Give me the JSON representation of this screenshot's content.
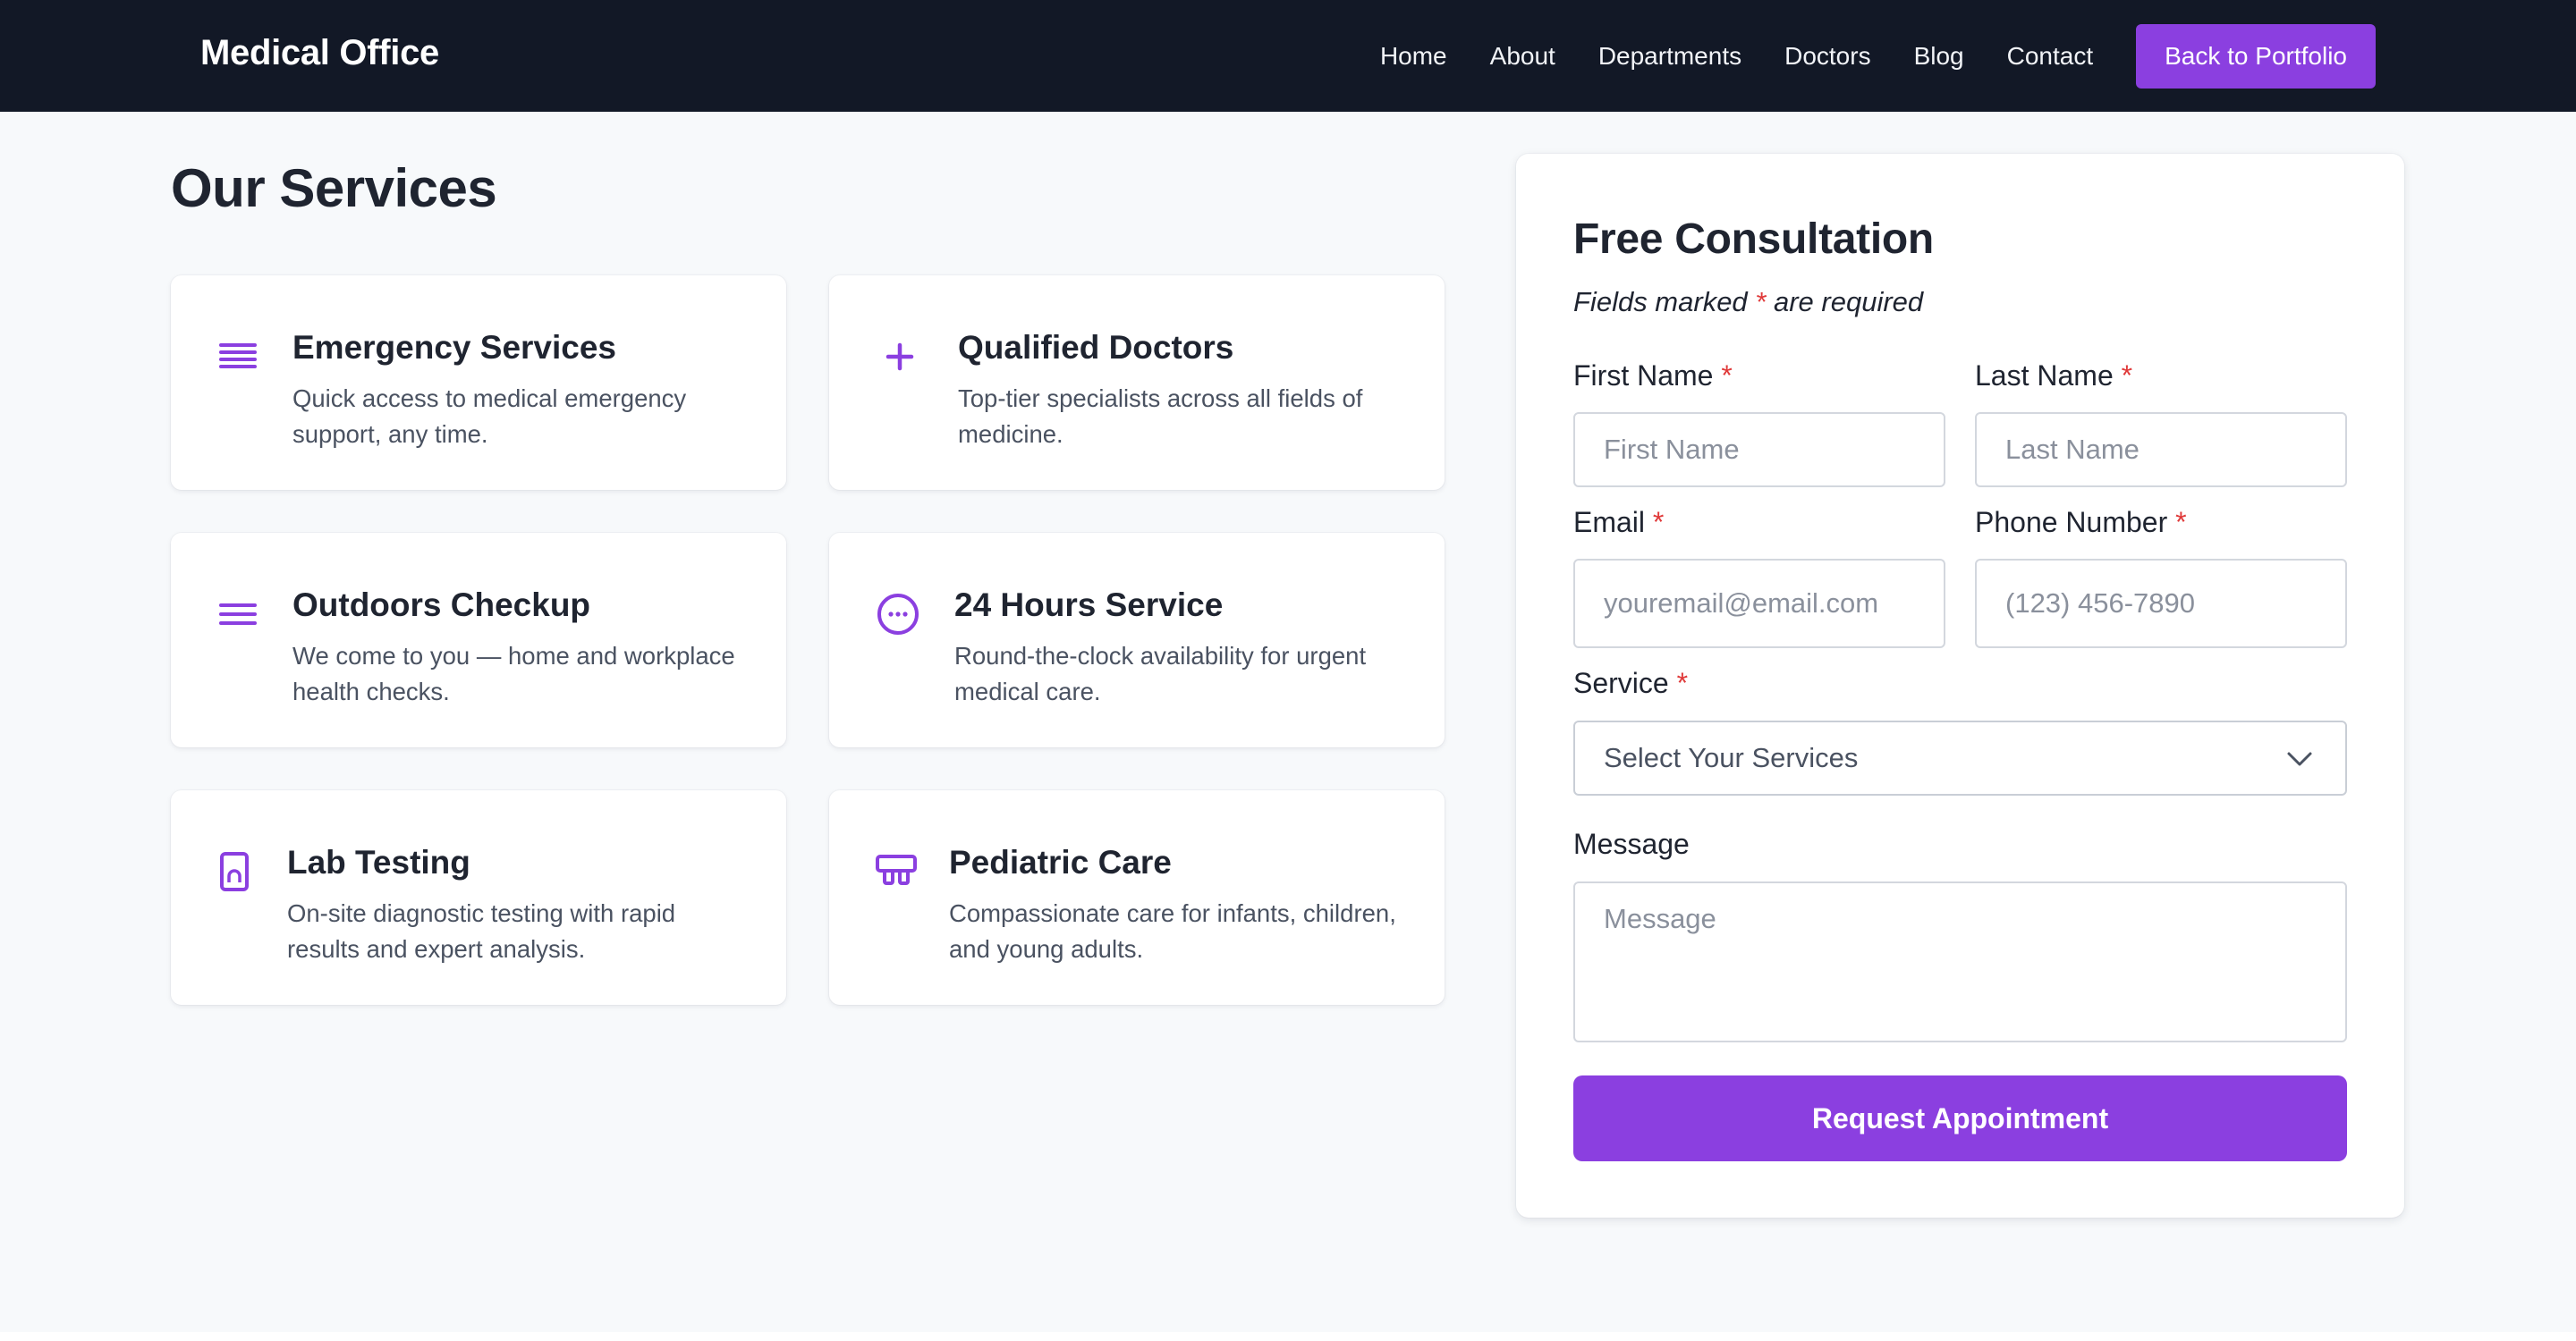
{
  "colors": {
    "accent": "#8b3fe0",
    "navbar_bg": "#121826",
    "page_bg": "#f7f9fb",
    "required": "#e03a3a"
  },
  "navbar": {
    "brand": "Medical Office",
    "links": [
      "Home",
      "About",
      "Departments",
      "Doctors",
      "Blog",
      "Contact"
    ],
    "cta_label": "Back to Portfolio"
  },
  "services": {
    "title": "Our Services",
    "items": [
      {
        "icon": "list-icon",
        "title": "Emergency Services",
        "desc": "Quick access to medical emergency support, any time."
      },
      {
        "icon": "plus-icon",
        "title": "Qualified Doctors",
        "desc": "Top-tier specialists across all fields of medicine."
      },
      {
        "icon": "menu-lines-icon",
        "title": "Outdoors Checkup",
        "desc": "We come to you — home and workplace health checks."
      },
      {
        "icon": "ellipsis-circle-icon",
        "title": "24 Hours Service",
        "desc": "Round-the-clock availability for urgent medical care."
      },
      {
        "icon": "tablet-icon",
        "title": "Lab Testing",
        "desc": "On-site diagnostic testing with rapid results and expert analysis."
      },
      {
        "icon": "cart-icon",
        "title": "Pediatric Care",
        "desc": "Compassionate care for infants, children, and young adults."
      }
    ]
  },
  "form": {
    "title": "Free Consultation",
    "note_before": "Fields marked ",
    "note_star": "*",
    "note_after": " are required",
    "first_name": {
      "label": "First Name",
      "placeholder": "First Name"
    },
    "last_name": {
      "label": "Last Name",
      "placeholder": "Last Name"
    },
    "email": {
      "label": "Email",
      "placeholder": "youremail@email.com"
    },
    "phone": {
      "label": "Phone Number",
      "placeholder": "(123) 456-7890"
    },
    "service": {
      "label": "Service",
      "selected": "Select Your Services"
    },
    "message": {
      "label": "Message",
      "placeholder": "Message"
    },
    "required_mark": "*",
    "submit_label": "Request Appointment"
  }
}
